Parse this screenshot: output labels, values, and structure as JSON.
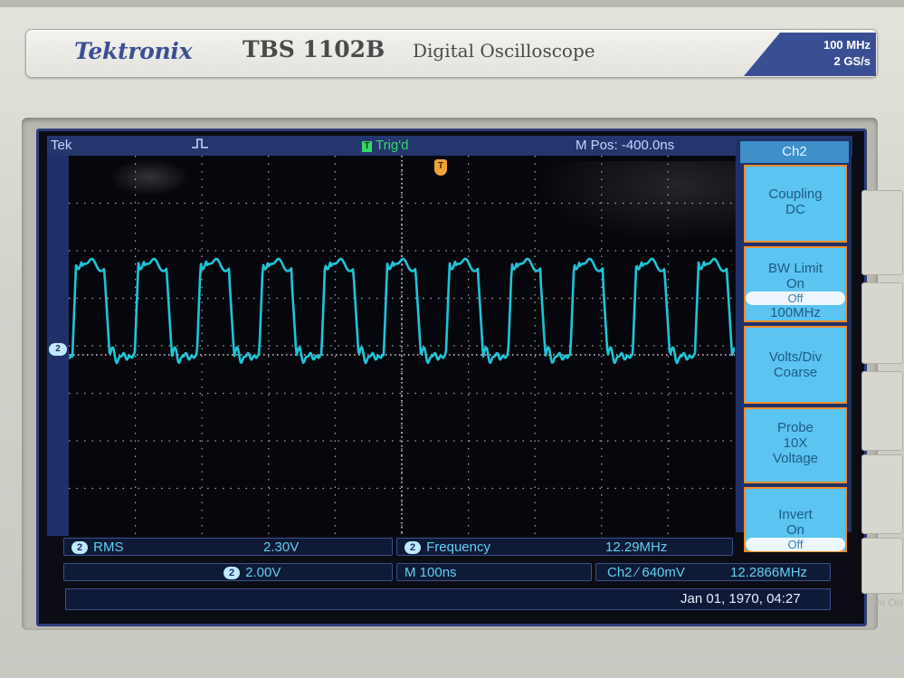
{
  "device": {
    "brand": "Tektronix",
    "model": "TBS 1102B",
    "product": "Digital Oscilloscope",
    "bandwidth": "100 MHz",
    "sample_rate": "2 GS/s"
  },
  "header": {
    "tek": "Tek",
    "trigger_status": "Trig'd",
    "trigger_mark": "T",
    "trigger_marker_label": "T",
    "m_pos": "M Pos: -400.0ns"
  },
  "channel_marker": "2",
  "menu": {
    "title": "Ch2",
    "coupling": {
      "label": "Coupling",
      "value": "DC"
    },
    "bw_limit": {
      "label": "BW Limit",
      "on": "On",
      "off": "Off",
      "value": "100MHz"
    },
    "volts_div": {
      "label": "Volts/Div",
      "value": "Coarse"
    },
    "probe": {
      "label": "Probe",
      "value1": "10X",
      "value2": "Voltage"
    },
    "invert": {
      "label": "Invert",
      "on": "On",
      "off": "Off"
    }
  },
  "measurements": [
    {
      "channel": "2",
      "name": "RMS",
      "value": "2.30V"
    },
    {
      "channel": "2",
      "name": "Frequency",
      "value": "12.29MHz"
    }
  ],
  "status": {
    "ch_badge": "2",
    "volts_div": "2.00V",
    "timebase": "M 100ns",
    "trigger_info": "Ch2 ∕ 640mV",
    "trigger_freq": "12.2866MHz",
    "datetime": "Jan 01, 1970, 04:27"
  },
  "waveform": {
    "color": "#22cfe0",
    "shape": "square-like with ringing",
    "frequency_mhz": 12.29,
    "cycles_visible": 10.7
  },
  "side_text": "Dhl Ori"
}
